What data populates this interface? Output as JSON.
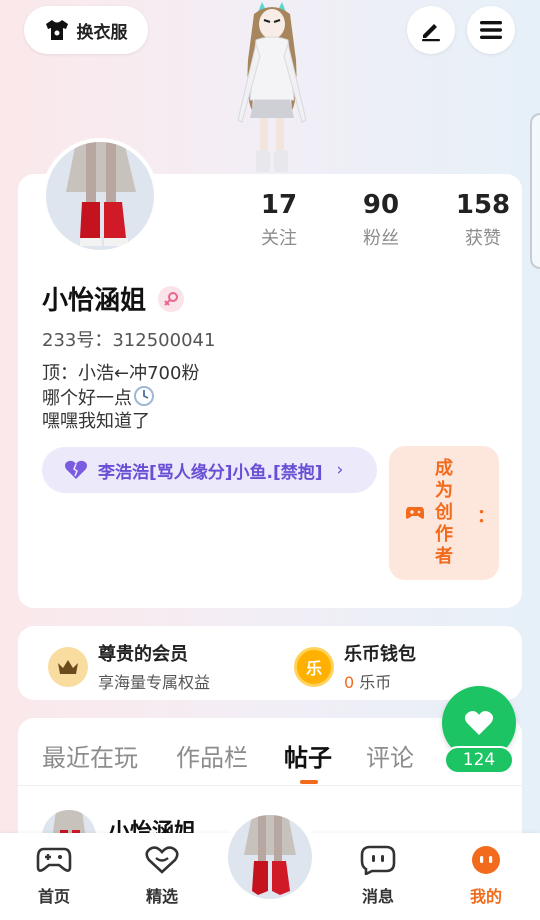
{
  "top_bar": {
    "dress_up_label": "换衣服"
  },
  "stats": [
    {
      "num": "17",
      "label": "关注"
    },
    {
      "num": "90",
      "label": "粉丝"
    },
    {
      "num": "158",
      "label": "获赞"
    }
  ],
  "profile": {
    "name": "小怡涵姐",
    "uid": "233号：312500041",
    "bio_line1": "顶：小浩←冲700粉",
    "bio_line2": "哪个好一点",
    "bio_line3": "嘿嘿我知道了",
    "fan_group": "李浩浩[骂人缘分]小鱼.[禁抱]",
    "creator_label": "成为创作者",
    "creator_suffix": "："
  },
  "vip": {
    "title": "尊贵的会员",
    "subtitle": "享海量专属权益"
  },
  "wallet": {
    "title": "乐币钱包",
    "coin_glyph": "乐",
    "amount": "0",
    "unit": " 乐币"
  },
  "tabs": [
    "最近在玩",
    "作品栏",
    "帖子",
    "评论"
  ],
  "active_tab": "帖子",
  "post": {
    "author": "小怡涵姐"
  },
  "like": {
    "count": "124"
  },
  "nav": [
    {
      "label": "首页",
      "icon": "gamepad-icon"
    },
    {
      "label": "精选",
      "icon": "heart-outline-icon"
    },
    {
      "label": "消息",
      "icon": "chat-icon"
    },
    {
      "label": "我的",
      "icon": "face-icon"
    }
  ],
  "colors": {
    "accent": "#f26b1d",
    "like_green": "#1cc464",
    "fan_purple": "#6a4fd6"
  }
}
